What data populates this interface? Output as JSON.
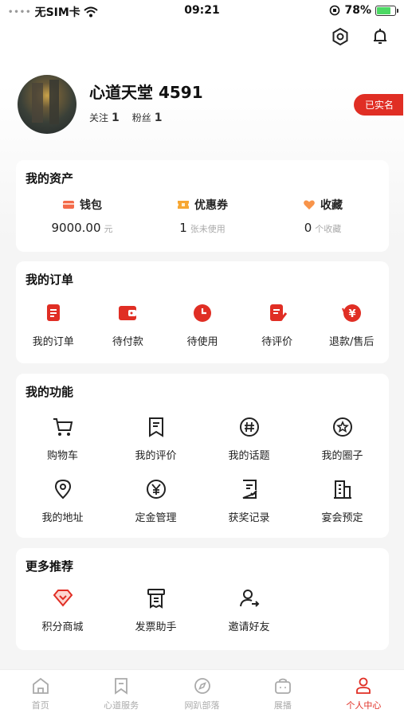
{
  "status_bar": {
    "carrier": "无SIM卡",
    "time": "09:21",
    "battery": "78%"
  },
  "profile": {
    "username": "心道天堂 4591",
    "following_label": "关注",
    "following_count": "1",
    "fans_label": "粉丝",
    "fans_count": "1",
    "verified_badge": "已实名"
  },
  "assets": {
    "title": "我的资产",
    "items": [
      {
        "label": "钱包",
        "value": "9000.00",
        "unit": "元"
      },
      {
        "label": "优惠券",
        "value": "1",
        "unit": "张未使用"
      },
      {
        "label": "收藏",
        "value": "0",
        "unit": "个收藏"
      }
    ]
  },
  "orders": {
    "title": "我的订单",
    "items": [
      "我的订单",
      "待付款",
      "待使用",
      "待评价",
      "退款/售后"
    ]
  },
  "functions": {
    "title": "我的功能",
    "items": [
      "购物车",
      "我的评价",
      "我的话题",
      "我的圈子",
      "我的地址",
      "定金管理",
      "获奖记录",
      "宴会预定"
    ]
  },
  "recommend": {
    "title": "更多推荐",
    "items": [
      "积分商城",
      "发票助手",
      "邀请好友"
    ]
  },
  "tabbar": {
    "items": [
      "首页",
      "心道服务",
      "网趴部落",
      "展播",
      "个人中心"
    ],
    "active_index": 4
  },
  "colors": {
    "accent": "#e02e24",
    "background": "#f5f5f5"
  }
}
